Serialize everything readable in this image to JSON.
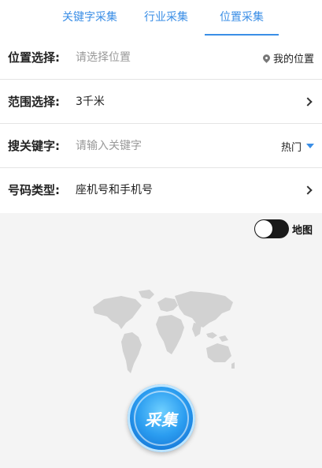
{
  "tabs": [
    {
      "label": "关键字采集"
    },
    {
      "label": "行业采集"
    },
    {
      "label": "位置采集"
    }
  ],
  "active_tab": "位置采集",
  "form": {
    "location": {
      "label": "位置选择:",
      "placeholder": "请选择位置",
      "action": "我的位置"
    },
    "range": {
      "label": "范围选择:",
      "value": "3千米"
    },
    "keyword": {
      "label": "搜关键字:",
      "placeholder": "请输入关键字",
      "action": "热门"
    },
    "number_type": {
      "label": "号码类型:",
      "value": "座机号和手机号"
    }
  },
  "map_toggle": {
    "label": "地图",
    "on": false
  },
  "collect_button": {
    "label": "采集"
  },
  "colors": {
    "accent": "#3a8ee6",
    "button": "#2b9df0"
  }
}
